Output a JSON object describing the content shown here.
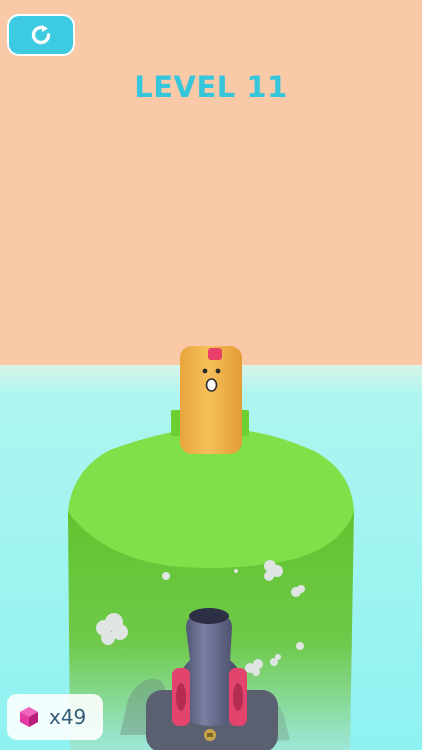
{
  "level": {
    "title": "LEVEL 11"
  },
  "restart": {
    "icon": "restart-icon"
  },
  "gems": {
    "icon": "gem-icon",
    "count": "x49"
  },
  "colors": {
    "sky": "#f9c9a8",
    "water": "#8ff2f1",
    "platform_top": "#7fe04a",
    "platform_side": "#63c62f",
    "character": "#f0b64a",
    "accent": "#3ccbe0",
    "gem": "#e43aa4"
  }
}
